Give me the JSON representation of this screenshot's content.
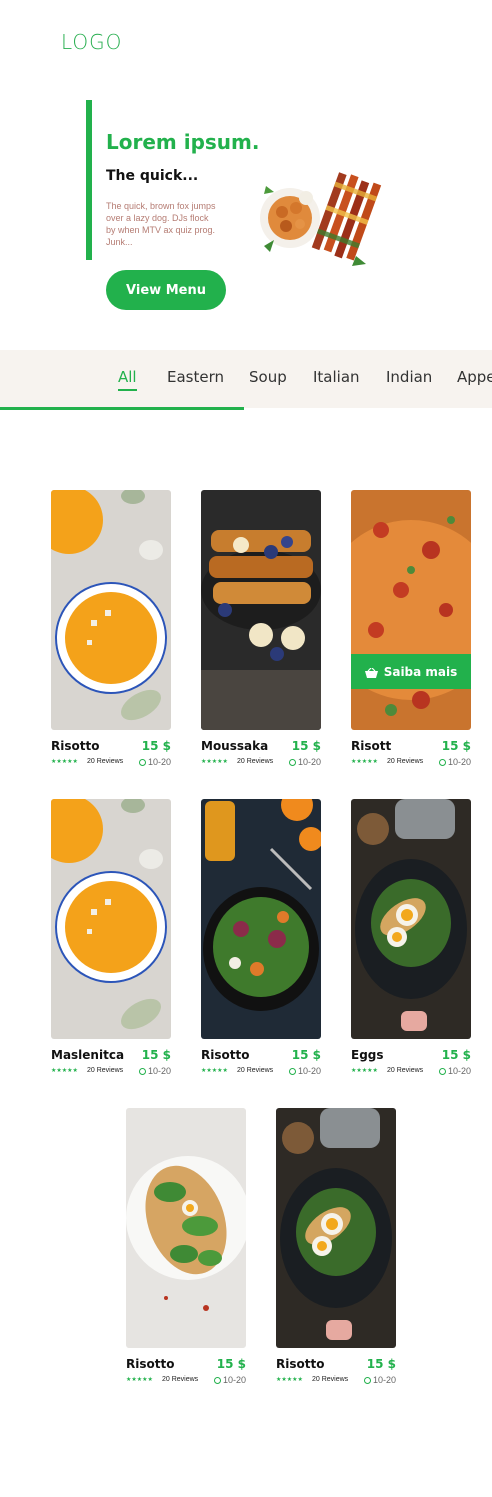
{
  "header": {
    "logo": "LOGO"
  },
  "hero": {
    "title": "Lorem ipsum.",
    "subtitle": "The quick...",
    "body": "The quick, brown fox jumps over a lazy dog. DJs flock by when MTV ax quiz prog. Junk...",
    "button_label": "View Menu"
  },
  "categories": {
    "items": [
      "All",
      "Eastern",
      "Soup",
      "Italian",
      "Indian",
      "Appe"
    ],
    "active": "All",
    "scroll_progress": 0.5
  },
  "cards": [
    {
      "name": "Risotto",
      "price": "15 $",
      "stars": "★★★★★",
      "reviews": "20 Reviews",
      "time": "10-20",
      "image": "soup"
    },
    {
      "name": "Moussaka",
      "price": "15 $",
      "stars": "★★★★★",
      "reviews": "20 Reviews",
      "time": "10-20",
      "image": "french-toast"
    },
    {
      "name": "Risott",
      "price": "15 $",
      "stars": "★★★★★",
      "reviews": "20 Reviews",
      "time": "10-20",
      "image": "pizza",
      "hover_label": "Saiba mais"
    },
    {
      "name": "Maslenitca",
      "price": "15 $",
      "stars": "★★★★★",
      "reviews": "20 Reviews",
      "time": "10-20",
      "image": "soup"
    },
    {
      "name": "Risotto",
      "price": "15 $",
      "stars": "★★★★★",
      "reviews": "20 Reviews",
      "time": "10-20",
      "image": "salad"
    },
    {
      "name": "Eggs",
      "price": "15 $",
      "stars": "★★★★★",
      "reviews": "20 Reviews",
      "time": "10-20",
      "image": "eggs"
    },
    {
      "name": "Risotto",
      "price": "15 $",
      "stars": "★★★★★",
      "reviews": "20 Reviews",
      "time": "10-20",
      "image": "toast"
    },
    {
      "name": "Risotto",
      "price": "15 $",
      "stars": "★★★★★",
      "reviews": "20 Reviews",
      "time": "10-20",
      "image": "eggs"
    }
  ],
  "colors": {
    "accent": "#22b14c",
    "category_bar": "#f7f3ef",
    "hero_body": "#b57c73"
  }
}
